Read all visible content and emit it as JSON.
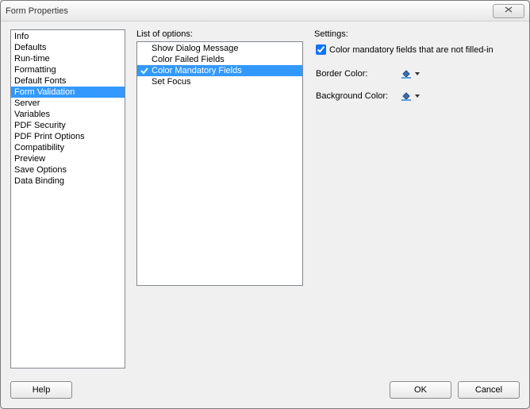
{
  "title": "Form Properties",
  "nav": {
    "items": [
      "Info",
      "Defaults",
      "Run-time",
      "Formatting",
      "Default Fonts",
      "Form Validation",
      "Server",
      "Variables",
      "PDF Security",
      "PDF Print Options",
      "Compatibility",
      "Preview",
      "Save Options",
      "Data Binding"
    ],
    "selected_index": 5
  },
  "options": {
    "label": "List of options:",
    "items": [
      {
        "label": "Show Dialog Message",
        "checked": false
      },
      {
        "label": "Color Failed Fields",
        "checked": false
      },
      {
        "label": "Color Mandatory Fields",
        "checked": true
      },
      {
        "label": "Set Focus",
        "checked": false
      }
    ],
    "selected_index": 2
  },
  "settings": {
    "label": "Settings:",
    "checkbox_label": "Color mandatory fields that are not filled-in",
    "checkbox_checked": true,
    "border_color_label": "Border Color:",
    "background_color_label": "Background Color:"
  },
  "buttons": {
    "help": "Help",
    "ok": "OK",
    "cancel": "Cancel"
  }
}
